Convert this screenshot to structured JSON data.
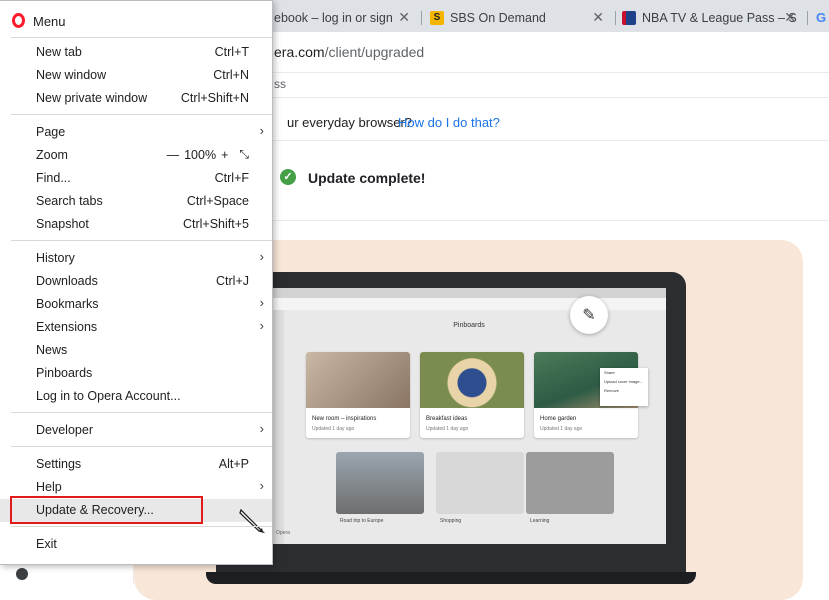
{
  "browser": {
    "tabs": [
      {
        "title": "ebook – log in or sign",
        "icon": "facebook-favicon",
        "color": "#1877f2"
      },
      {
        "title": "SBS On Demand",
        "icon": "sbs-favicon",
        "color": "#f5b400"
      },
      {
        "title": "NBA TV & League Pass – S",
        "icon": "nba-favicon",
        "color": "#c8102e"
      },
      {
        "title": "G",
        "icon": "google-favicon",
        "color": "#4285f4"
      }
    ],
    "address": {
      "host": "era.com",
      "path": "/client/upgraded"
    },
    "bookmark_fragment": "ss"
  },
  "page": {
    "question": "ur everyday browser?",
    "question_link": "How do I do that?",
    "update_status": "Update complete!",
    "status_color": "#43a047",
    "preview": {
      "screen_title": "Pinboards",
      "cards": [
        {
          "name": "New room – inspirations",
          "sub": "Updated 1 day ago"
        },
        {
          "name": "Breakfast ideas",
          "sub": "Updated 1 day ago"
        },
        {
          "name": "Home garden",
          "sub": "Updated 1 day ago"
        }
      ],
      "row2": [
        "Road trip to Europe",
        "Shopping",
        "Learning"
      ],
      "context_menu": [
        "Share",
        "Upload cover image...",
        "Remove"
      ],
      "footer": "Opera"
    }
  },
  "menu": {
    "title": "Menu",
    "accent_color": "#ff1b2d",
    "highlight_color": "#e11a1a",
    "groups": [
      [
        {
          "label": "New tab",
          "shortcut": "Ctrl+T"
        },
        {
          "label": "New window",
          "shortcut": "Ctrl+N"
        },
        {
          "label": "New private window",
          "shortcut": "Ctrl+Shift+N"
        }
      ],
      [
        {
          "label": "Page",
          "submenu": true
        },
        {
          "label": "Zoom",
          "zoom": {
            "minus": "—",
            "value": "100%",
            "plus": "+",
            "fullscreen_icon": "fullscreen-icon"
          }
        },
        {
          "label": "Find...",
          "shortcut": "Ctrl+F"
        },
        {
          "label": "Search tabs",
          "shortcut": "Ctrl+Space"
        },
        {
          "label": "Snapshot",
          "shortcut": "Ctrl+Shift+5"
        }
      ],
      [
        {
          "label": "History",
          "submenu": true
        },
        {
          "label": "Downloads",
          "shortcut": "Ctrl+J"
        },
        {
          "label": "Bookmarks",
          "submenu": true
        },
        {
          "label": "Extensions",
          "submenu": true
        },
        {
          "label": "News"
        },
        {
          "label": "Pinboards"
        },
        {
          "label": "Log in to Opera Account..."
        }
      ],
      [
        {
          "label": "Developer",
          "submenu": true
        }
      ],
      [
        {
          "label": "Settings",
          "shortcut": "Alt+P"
        },
        {
          "label": "Help",
          "submenu": true
        },
        {
          "label": "Update & Recovery...",
          "highlighted": true
        }
      ],
      [
        {
          "label": "Exit"
        }
      ]
    ]
  }
}
